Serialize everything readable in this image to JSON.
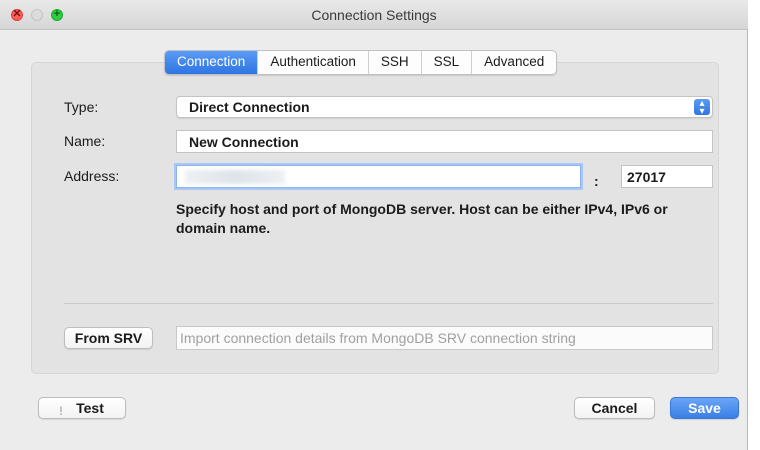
{
  "window": {
    "title": "Connection Settings",
    "controls": [
      "close",
      "minimize",
      "maximize"
    ],
    "close_glyph": "✕",
    "max_glyph": "+"
  },
  "tabs": [
    {
      "label": "Connection",
      "active": true
    },
    {
      "label": "Authentication",
      "active": false
    },
    {
      "label": "SSH",
      "active": false
    },
    {
      "label": "SSL",
      "active": false
    },
    {
      "label": "Advanced",
      "active": false
    }
  ],
  "form": {
    "type_label": "Type:",
    "type_value": "Direct Connection",
    "name_label": "Name:",
    "name_value": "New Connection",
    "address_label": "Address:",
    "address_value": "",
    "address_separator": ":",
    "port_value": "27017",
    "hint": "Specify host and port of MongoDB server. Host can be either IPv4, IPv6 or domain name."
  },
  "srv": {
    "button_label": "From SRV",
    "placeholder": "Import connection details from MongoDB SRV connection string"
  },
  "footer": {
    "test_label": "Test",
    "test_icon": "!",
    "cancel_label": "Cancel",
    "save_label": "Save"
  },
  "colors": {
    "accent": "#3a7fe6",
    "window_bg": "#ececec",
    "panel_bg": "#e3e3e3"
  }
}
